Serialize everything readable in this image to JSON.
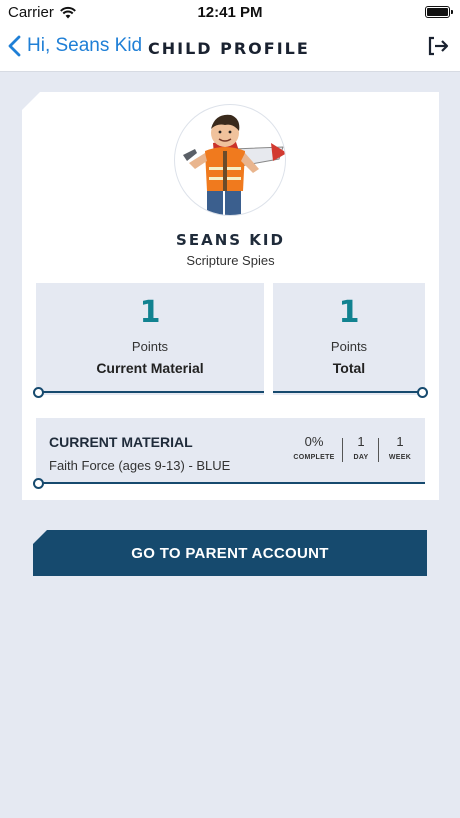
{
  "status_bar": {
    "carrier": "Carrier",
    "time": "12:41 PM"
  },
  "nav": {
    "back_label": "Hi, Seans Kid",
    "title": "CHILD PROFILE"
  },
  "profile": {
    "name": "SEANS KID",
    "group": "Scripture Spies"
  },
  "stats": [
    {
      "value": "1",
      "label": "Points",
      "sublabel": "Current Material"
    },
    {
      "value": "1",
      "label": "Points",
      "sublabel": "Total"
    }
  ],
  "current_material": {
    "title": "CURRENT MATERIAL",
    "name": "Faith Force (ages 9-13) - BLUE",
    "complete_value": "0%",
    "complete_label": "COMPLETE",
    "day_value": "1",
    "day_label": "DAY",
    "week_value": "1",
    "week_label": "WEEK"
  },
  "parent_button": {
    "label": "GO TO PARENT ACCOUNT"
  },
  "colors": {
    "accent": "#118290",
    "navy": "#164a6e",
    "link": "#1f7fd6",
    "background": "#e5e9f2"
  }
}
